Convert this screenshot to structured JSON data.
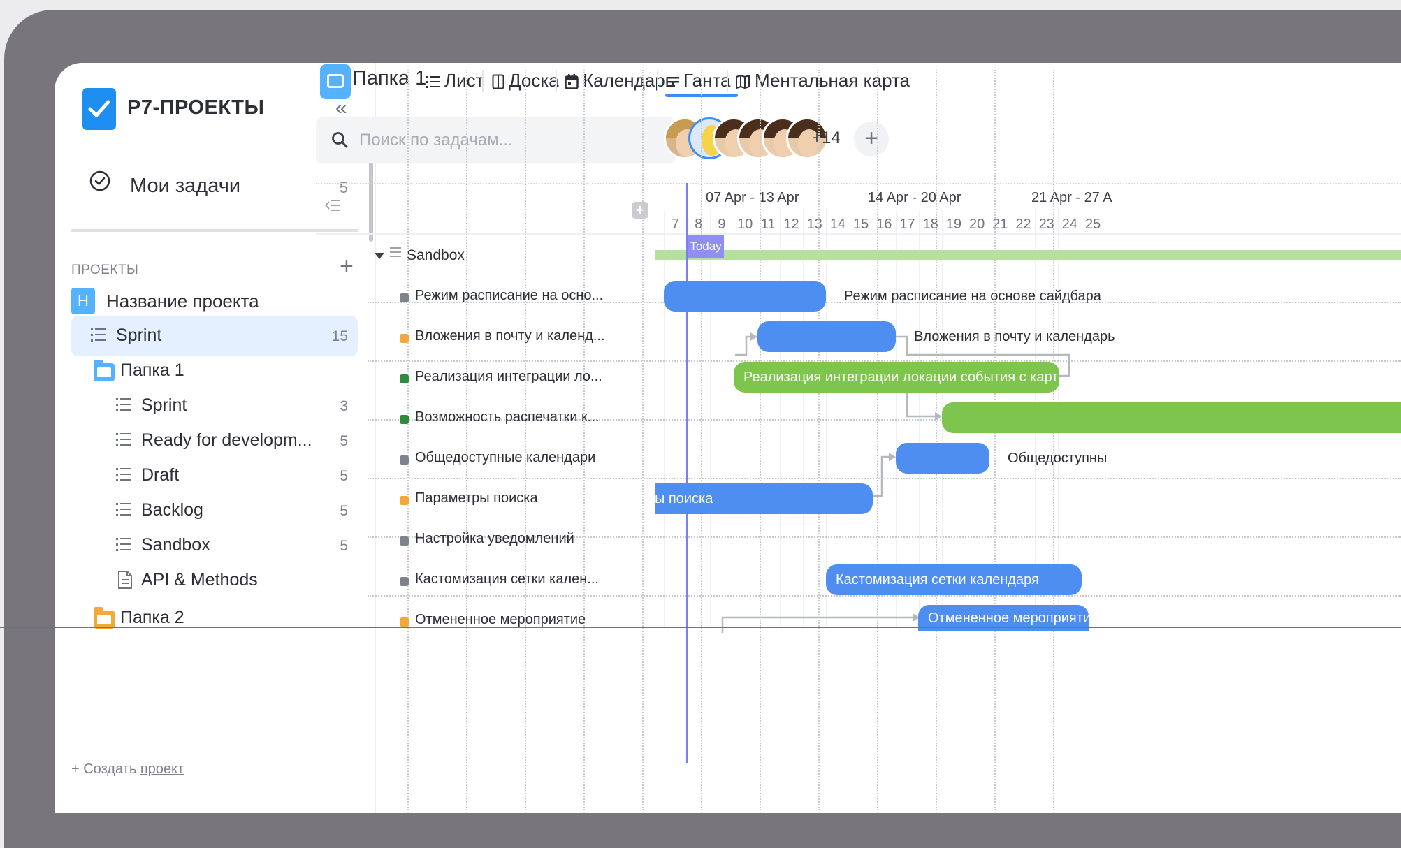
{
  "app": {
    "title": "Р7-ПРОЕКТЫ"
  },
  "sidebar": {
    "my_tasks": {
      "label": "Мои задачи",
      "count": "5"
    },
    "projects_header": "ПРОЕКТЫ",
    "project": {
      "badge": "H",
      "label": "Название проекта"
    },
    "items": [
      {
        "label": "Sprint",
        "count": "15",
        "icon": "list-icon",
        "active": true
      },
      {
        "label": "Папка 1",
        "count": "",
        "icon": "folder-icon"
      },
      {
        "label": "Sprint",
        "count": "3",
        "icon": "list-icon"
      },
      {
        "label": "Ready for developm...",
        "count": "5",
        "icon": "list-icon"
      },
      {
        "label": "Draft",
        "count": "5",
        "icon": "list-icon"
      },
      {
        "label": "Backlog",
        "count": "5",
        "icon": "list-icon"
      },
      {
        "label": "Sandbox",
        "count": "5",
        "icon": "list-icon"
      },
      {
        "label": "API & Methods",
        "count": "",
        "icon": "document-icon"
      },
      {
        "label": "Папка 2",
        "count": "",
        "icon": "folder-icon"
      }
    ],
    "create_prefix": "+ Создать ",
    "create_link": "проект"
  },
  "header": {
    "folder_title": "Папка 1",
    "tabs": [
      {
        "label": "Лист",
        "icon": "list-icon"
      },
      {
        "label": "Доска",
        "icon": "board-icon"
      },
      {
        "label": "Календарь",
        "icon": "calendar-icon"
      },
      {
        "label": "Ганта",
        "icon": "gantt-icon",
        "active": true
      },
      {
        "label": "Ментальная карта",
        "icon": "map-icon"
      }
    ]
  },
  "search": {
    "placeholder": "Поиск по задачам..."
  },
  "members": {
    "more": "+14",
    "add": "+"
  },
  "gantt": {
    "weeks": [
      "07 Apr - 13 Apr",
      "14 Apr - 20 Apr",
      "21 Apr - 27 A"
    ],
    "days": [
      "7",
      "8",
      "9",
      "10",
      "11",
      "12",
      "13",
      "14",
      "15",
      "16",
      "17",
      "18",
      "19",
      "20",
      "21",
      "22",
      "23",
      "24",
      "25"
    ],
    "today": "Today",
    "group": "Sandbox",
    "tasks": [
      {
        "name": "Режим расписание на осно...",
        "bar_label": "",
        "ext_label": "Режим расписание на основе сайдбара",
        "status_color": "#7d828c",
        "bar_color": "#4f8ef1"
      },
      {
        "name": "Вложения в почту и календ...",
        "bar_label": "",
        "ext_label": "Вложения в почту и календарь",
        "status_color": "#f3a93a",
        "bar_color": "#4f8ef1"
      },
      {
        "name": "Реализация интеграции ло...",
        "bar_label": "Реализация интеграции локации события с картами",
        "ext_label": "",
        "status_color": "#2f8a3e",
        "bar_color": "#7dc54c"
      },
      {
        "name": "Возможность распечатки к...",
        "bar_label": "",
        "ext_label": "",
        "status_color": "#2f8a3e",
        "bar_color": "#7dc54c"
      },
      {
        "name": "Общедоступные календари",
        "bar_label": "",
        "ext_label": "Общедоступны",
        "status_color": "#7d828c",
        "bar_color": "#4f8ef1"
      },
      {
        "name": "Параметры поиска",
        "bar_label": "ы поиска",
        "ext_label": "",
        "status_color": "#f3a93a",
        "bar_color": "#4f8ef1"
      },
      {
        "name": "Настройка уведомлений",
        "bar_label": "",
        "ext_label": "",
        "status_color": "#7d828c",
        "bar_color": "#4f8ef1"
      },
      {
        "name": "Кастомизация сетки кален...",
        "bar_label": "Кастомизация сетки календаря",
        "ext_label": "",
        "status_color": "#7d828c",
        "bar_color": "#4f8ef1"
      },
      {
        "name": "Отмененное мероприятие",
        "bar_label": "Отмененное мероприятие",
        "ext_label": "",
        "status_color": "#f3a93a",
        "bar_color": "#4f8ef1"
      }
    ]
  }
}
